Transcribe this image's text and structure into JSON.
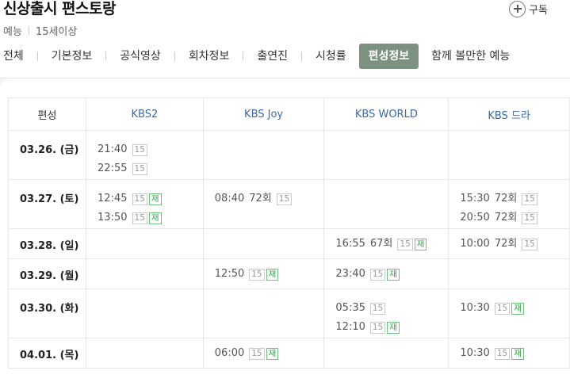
{
  "program": {
    "title": "신상출시 편스토랑",
    "genre": "예능",
    "rating": "15세이상",
    "subscribe_label": "구독"
  },
  "tabs": [
    {
      "label": "전체",
      "active": false
    },
    {
      "label": "기본정보",
      "active": false
    },
    {
      "label": "공식영상",
      "active": false
    },
    {
      "label": "회차정보",
      "active": false
    },
    {
      "label": "출연진",
      "active": false
    },
    {
      "label": "시청률",
      "active": false
    },
    {
      "label": "편성정보",
      "active": true
    },
    {
      "label": "함께 볼만한 예능",
      "active": false
    }
  ],
  "schedule": {
    "corner_label": "편성",
    "channels": [
      "KBS2",
      "KBS Joy",
      "KBS WORLD",
      "KBS 드라"
    ],
    "rows": [
      {
        "date": "03.26. (금)",
        "cells": [
          [
            {
              "time": "21:40",
              "badges": [
                "15"
              ]
            },
            {
              "time": "22:55",
              "badges": [
                "15"
              ]
            }
          ],
          [],
          [],
          []
        ]
      },
      {
        "date": "03.27. (토)",
        "cells": [
          [
            {
              "time": "12:45",
              "badges": [
                "15",
                "재"
              ]
            },
            {
              "time": "13:50",
              "badges": [
                "15",
                "재"
              ]
            }
          ],
          [
            {
              "time": "08:40",
              "ep": "72회",
              "badges": [
                "15"
              ]
            }
          ],
          [],
          [
            {
              "time": "15:30",
              "ep": "72회",
              "badges": [
                "15"
              ]
            },
            {
              "time": "20:50",
              "ep": "72회",
              "badges": [
                "15"
              ]
            }
          ]
        ]
      },
      {
        "date": "03.28. (일)",
        "cells": [
          [],
          [],
          [
            {
              "time": "16:55",
              "ep": "67회",
              "badges": [
                "15",
                "재"
              ]
            }
          ],
          [
            {
              "time": "10:00",
              "ep": "72회",
              "badges": [
                "15"
              ]
            }
          ]
        ]
      },
      {
        "date": "03.29. (월)",
        "cells": [
          [],
          [
            {
              "time": "12:50",
              "badges": [
                "15",
                "재"
              ]
            }
          ],
          [
            {
              "time": "23:40",
              "badges": [
                "15",
                "재"
              ]
            }
          ],
          []
        ]
      },
      {
        "date": "03.30. (화)",
        "cells": [
          [],
          [],
          [
            {
              "time": "05:35",
              "badges": [
                "15"
              ]
            },
            {
              "time": "12:10",
              "badges": [
                "15",
                "재"
              ]
            }
          ],
          [
            {
              "time": "10:30",
              "badges": [
                "15",
                "재"
              ]
            }
          ]
        ]
      },
      {
        "date": "04.01. (목)",
        "cells": [
          [],
          [
            {
              "time": "06:00",
              "badges": [
                "15",
                "재"
              ]
            }
          ],
          [],
          [
            {
              "time": "10:30",
              "badges": [
                "15",
                "재"
              ]
            }
          ]
        ]
      }
    ]
  },
  "colors": {
    "active_tab_bg": "#7c9180",
    "channel_text": "#3a6aa8",
    "rerun_badge": "#3aa24c"
  }
}
